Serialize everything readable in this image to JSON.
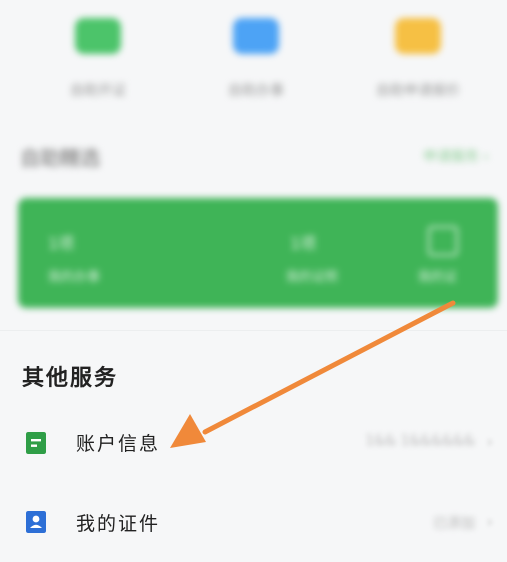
{
  "shortcuts": [
    {
      "label": "自助开证",
      "color": "#4cc46a"
    },
    {
      "label": "自助办事",
      "color": "#4da3f5"
    },
    {
      "label": "自助申请报价",
      "color": "#f6c044"
    }
  ],
  "featured": {
    "title": "自助精选",
    "more_label": "申请服务 ›",
    "card": {
      "color": "#3fb457",
      "left_value": "1项",
      "left_label": "我的办事",
      "mid_value": "1项",
      "mid_label": "我的证照",
      "right_label": "我的证"
    }
  },
  "other_services": {
    "title": "其他服务",
    "items": [
      {
        "label": "账户信息",
        "value": "1&& 1&&&&&&",
        "icon": "document-icon",
        "icon_color": "#2f9e47"
      },
      {
        "label": "我的证件",
        "value": "已添加",
        "icon": "id-card-icon",
        "icon_color": "#2d6fd6"
      }
    ]
  },
  "annotation": {
    "arrow_color": "#f0893a"
  }
}
